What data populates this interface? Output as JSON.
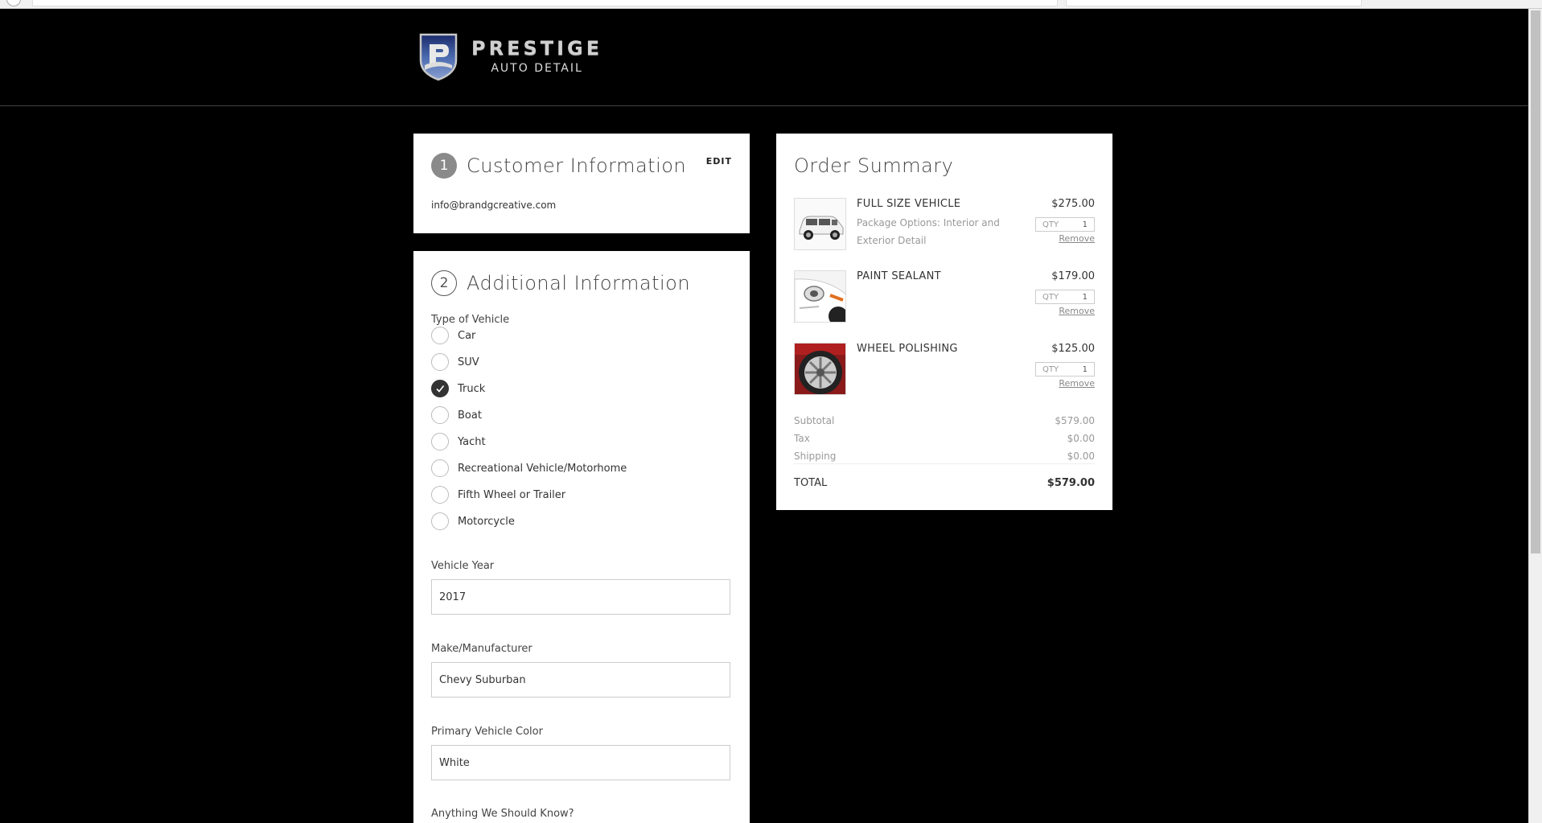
{
  "brand": {
    "name": "PRESTIGE",
    "tagline": "AUTO DETAIL"
  },
  "customer": {
    "step": "1",
    "title": "Customer Information",
    "edit_label": "EDIT",
    "email": "info@brandgcreative.com"
  },
  "additional": {
    "step": "2",
    "title": "Additional Information",
    "vehicle_type_label": "Type of Vehicle",
    "vehicle_types": [
      {
        "label": "Car",
        "checked": false
      },
      {
        "label": "SUV",
        "checked": false
      },
      {
        "label": "Truck",
        "checked": true
      },
      {
        "label": "Boat",
        "checked": false
      },
      {
        "label": "Yacht",
        "checked": false
      },
      {
        "label": "Recreational Vehicle/Motorhome",
        "checked": false
      },
      {
        "label": "Fifth Wheel or Trailer",
        "checked": false
      },
      {
        "label": "Motorcycle",
        "checked": false
      }
    ],
    "year_label": "Vehicle Year",
    "year_value": "2017",
    "make_label": "Make/Manufacturer",
    "make_value": "Chevy Suburban",
    "color_label": "Primary Vehicle Color",
    "color_value": "White",
    "notes_label": "Anything We Should Know?"
  },
  "order": {
    "title": "Order Summary",
    "qty_label": "QTY",
    "remove_label": "Remove",
    "items": [
      {
        "name": "FULL SIZE VEHICLE",
        "desc": "Package Options: Interior and Exterior Detail",
        "price": "$275.00",
        "qty": "1"
      },
      {
        "name": "PAINT SEALANT",
        "desc": "",
        "price": "$179.00",
        "qty": "1"
      },
      {
        "name": "WHEEL POLISHING",
        "desc": "",
        "price": "$125.00",
        "qty": "1"
      }
    ],
    "subtotal_label": "Subtotal",
    "subtotal": "$579.00",
    "tax_label": "Tax",
    "tax": "$0.00",
    "shipping_label": "Shipping",
    "shipping": "$0.00",
    "total_label": "TOTAL",
    "total": "$579.00"
  },
  "colors": {
    "background": "#000000",
    "card": "#ffffff",
    "checked": "#333333",
    "step_filled": "#8a8a8a"
  }
}
